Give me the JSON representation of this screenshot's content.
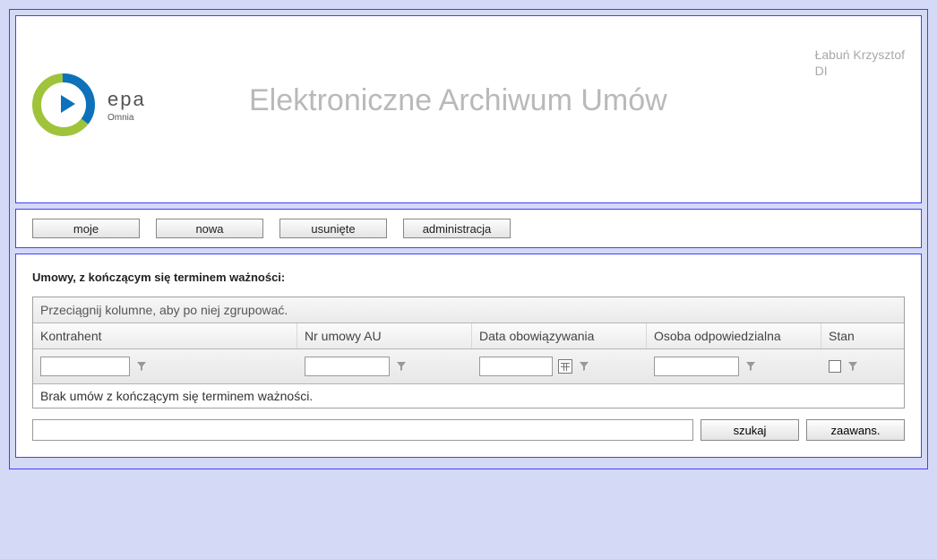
{
  "header": {
    "app_title": "Elektroniczne Archiwum Umów",
    "logo_epa": "epa",
    "logo_omnia": "Omnia",
    "user_name": "Łabuń Krzysztof",
    "user_dept": "DI"
  },
  "nav": {
    "moje": "moje",
    "nowa": "nowa",
    "usuniete": "usunięte",
    "administracja": "administracja"
  },
  "main": {
    "section_heading": "Umowy, z kończącym się terminem ważności:",
    "group_hint": "Przeciągnij kolumne, aby po niej zgrupować.",
    "columns": {
      "kontrahent": "Kontrahent",
      "nrumowy": "Nr umowy AU",
      "data": "Data obowiązywania",
      "osoba": "Osoba odpowiedzialna",
      "stan": "Stan"
    },
    "filters": {
      "kontrahent": "",
      "nrumowy": "",
      "data": "",
      "osoba": ""
    },
    "empty_message": "Brak umów z kończącym się terminem ważności.",
    "search_value": "",
    "szukaj": "szukaj",
    "zaawans": "zaawans."
  }
}
